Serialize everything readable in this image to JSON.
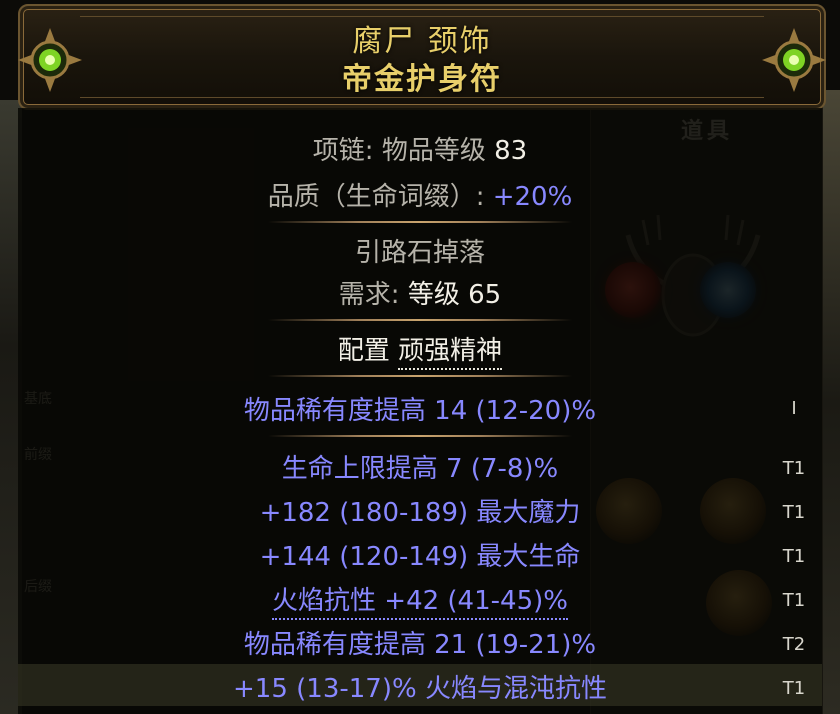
{
  "header": {
    "name": "腐尸 颈饰",
    "base": "帝金护身符"
  },
  "background": {
    "panel_title": "道具",
    "side_labels": [
      "基底",
      "前缀",
      "后缀"
    ]
  },
  "item": {
    "class_line_label": "项链: 物品等级 ",
    "item_level": "83",
    "quality_label": "品质（生命词缀）: ",
    "quality_value": "+20%",
    "source": "引路石掉落",
    "req_label": "需求: ",
    "req_value": "等级 65",
    "config_label": "配置 ",
    "config_value": "顽强精神",
    "implicit": "物品稀有度提高 14 (12-20)%",
    "implicit_tier": "I",
    "mods": [
      {
        "text": "生命上限提高 7 (7-8)%",
        "tier": "T1"
      },
      {
        "text": "+182 (180-189) 最大魔力",
        "tier": "T1"
      },
      {
        "text": "+144 (120-149) 最大生命",
        "tier": "T1"
      },
      {
        "text": "火焰抗性 +42 (41-45)%",
        "tier": "T1"
      },
      {
        "text": "物品稀有度提高 21 (19-21)%",
        "tier": "T2"
      },
      {
        "text": "+15 (13-17)% 火焰与混沌抗性",
        "tier": "T1"
      }
    ]
  },
  "colors": {
    "title": "#e8cf6a",
    "magic_blue": "#8888ff",
    "grey_text": "#b6b3aa",
    "white_text": "#f2efe6"
  },
  "icons": [
    "green-orb-ornament-icon",
    "amulet-icon",
    "red-gem-icon",
    "blue-gem-icon"
  ]
}
